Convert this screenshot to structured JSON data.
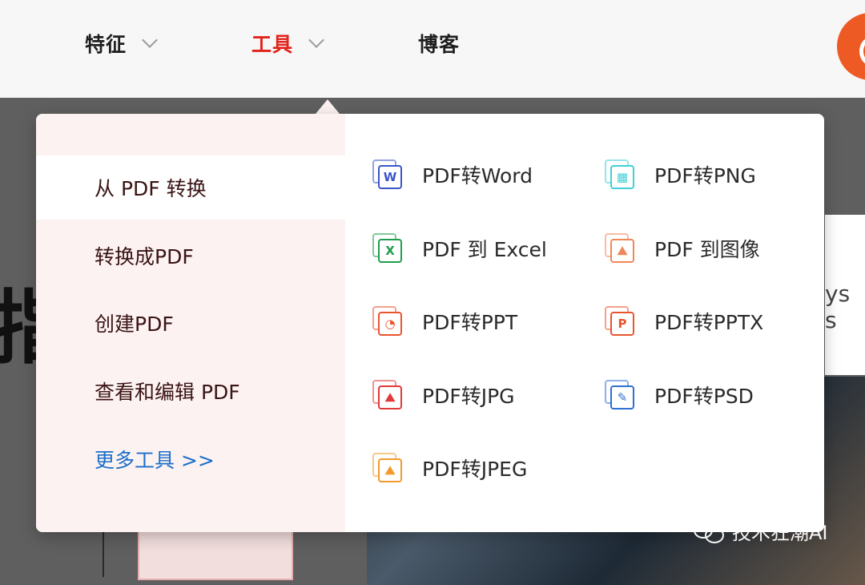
{
  "nav": {
    "features": "特征",
    "tools": "工具",
    "blog": "博客"
  },
  "background": {
    "headline_fragment": "指。",
    "side_text_fragment": "ys s"
  },
  "dropdown": {
    "categories": [
      {
        "label": "从 PDF 转换",
        "active": true
      },
      {
        "label": "转换成PDF",
        "active": false
      },
      {
        "label": "创建PDF",
        "active": false
      },
      {
        "label": "查看和编辑 PDF",
        "active": false
      },
      {
        "label": "更多工具 >>",
        "active": false
      }
    ],
    "tools": [
      {
        "label": "PDF转Word",
        "icon": "word-icon",
        "color": "#3a55c8",
        "glyph": "W"
      },
      {
        "label": "PDF转PNG",
        "icon": "png-icon",
        "color": "#3fd0d8",
        "glyph": "▦"
      },
      {
        "label": "PDF 到 Excel",
        "icon": "excel-icon",
        "color": "#1f9d4c",
        "glyph": "X"
      },
      {
        "label": "PDF 到图像",
        "icon": "image-icon",
        "color": "#f0875a",
        "glyph": "⛰"
      },
      {
        "label": "PDF转PPT",
        "icon": "ppt-icon",
        "color": "#e8552f",
        "glyph": "◔"
      },
      {
        "label": "PDF转PPTX",
        "icon": "pptx-icon",
        "color": "#e8552f",
        "glyph": "P"
      },
      {
        "label": "PDF转JPG",
        "icon": "jpg-icon",
        "color": "#e03a3a",
        "glyph": "⛰"
      },
      {
        "label": "PDF转PSD",
        "icon": "psd-icon",
        "color": "#2f6fd0",
        "glyph": "✎"
      },
      {
        "label": "PDF转JPEG",
        "icon": "jpeg-icon",
        "color": "#f29a2e",
        "glyph": "⛰"
      }
    ]
  },
  "watermark": {
    "text": "技术狂潮AI"
  },
  "colors": {
    "accent": "#e2231a",
    "link": "#1a6fc9",
    "brand_orange": "#ee5a24"
  }
}
